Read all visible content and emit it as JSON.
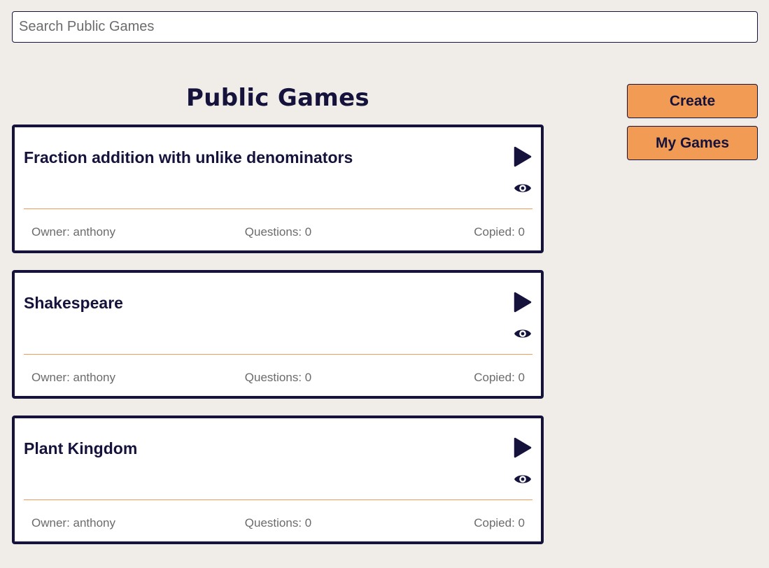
{
  "search": {
    "placeholder": "Search Public Games",
    "value": ""
  },
  "header": {
    "title": "Public Games"
  },
  "actions": {
    "create_label": "Create",
    "my_games_label": "My Games"
  },
  "games": [
    {
      "title": "Fraction addition with unlike denominators",
      "owner": "Owner: anthony",
      "questions": "Questions: 0",
      "copied": "Copied: 0"
    },
    {
      "title": "Shakespeare",
      "owner": "Owner: anthony",
      "questions": "Questions: 0",
      "copied": "Copied: 0"
    },
    {
      "title": "Plant Kingdom",
      "owner": "Owner: anthony",
      "questions": "Questions: 0",
      "copied": "Copied: 0"
    }
  ],
  "icons": {
    "play": "play-icon",
    "view": "eye-icon"
  },
  "colors": {
    "background": "#f0ece7",
    "primary": "#15133c",
    "accent": "#f29b54",
    "muted_text": "#6b6b6b",
    "card_background": "#ffffff"
  }
}
